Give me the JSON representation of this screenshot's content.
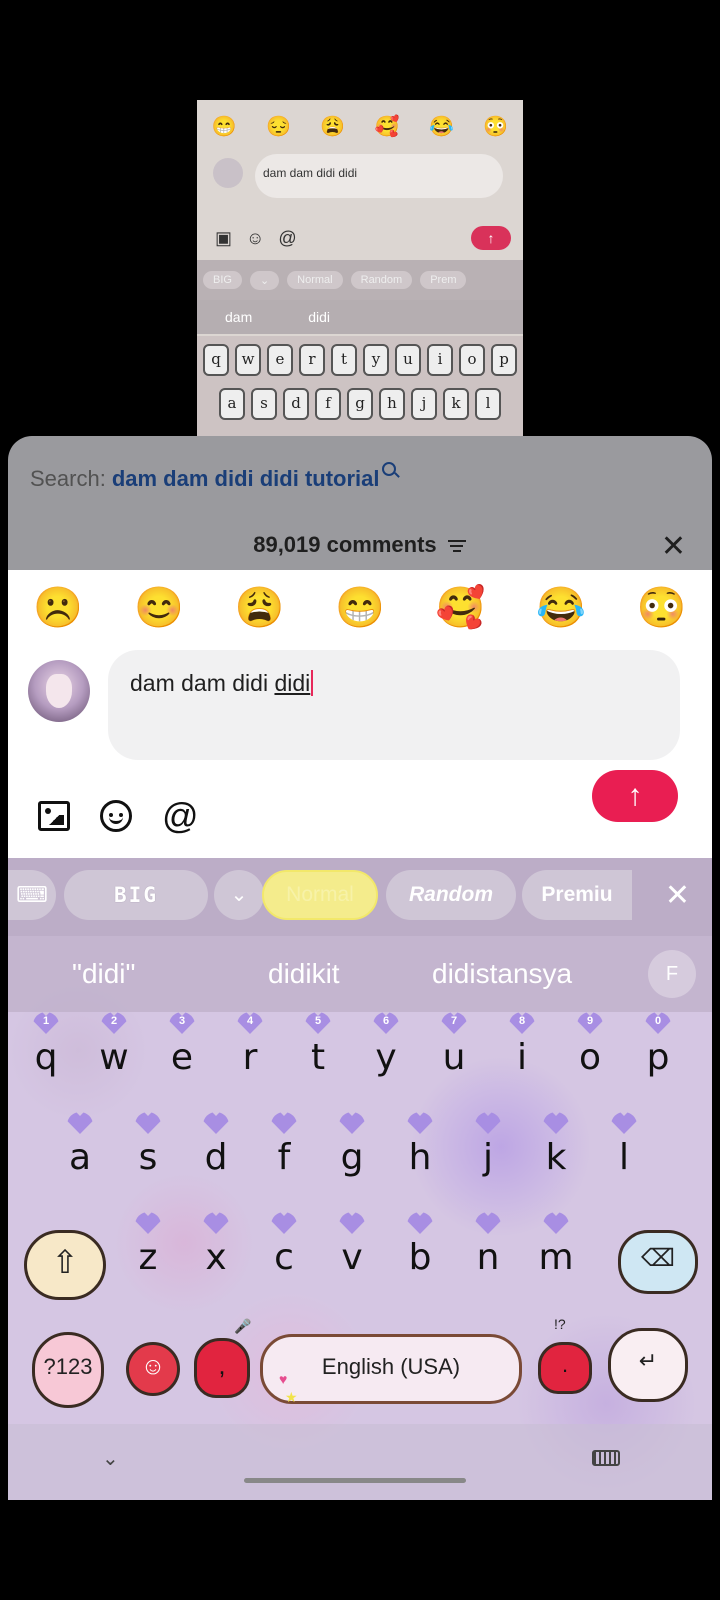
{
  "preview": {
    "emojis": [
      "😁",
      "😔",
      "😩",
      "🥰",
      "😂",
      "😳"
    ],
    "input_text": "dam dam didi didi",
    "send_label": "↑",
    "toolbar": [
      "BIG",
      "⌄",
      "Normal",
      "Random",
      "Prem"
    ],
    "suggestions": [
      "dam",
      "didi"
    ],
    "row1": [
      "q",
      "w",
      "e",
      "r",
      "t",
      "y",
      "u",
      "i",
      "o",
      "p"
    ],
    "row2": [
      "a",
      "s",
      "d",
      "f",
      "g",
      "h",
      "j",
      "k",
      "l"
    ]
  },
  "sheet": {
    "search_label": "Search:",
    "search_query": "dam dam didi didi tutorial",
    "comments_count": "89,019 comments",
    "close": "✕"
  },
  "compose": {
    "emojis": [
      "☹️",
      "😊",
      "😩",
      "😁",
      "🥰",
      "😂",
      "😳"
    ],
    "input_text": "dam dam didi ",
    "input_current_word": "didi",
    "send_label": "↑",
    "at_symbol": "@"
  },
  "keyboard": {
    "toolbar": {
      "theme_icon": "⌨",
      "big_label": "BIG",
      "chevron": "⌄",
      "normal_label": "Normal",
      "random_label": "Random",
      "premium_label": "Premiu",
      "close": "✕"
    },
    "suggestions": [
      "\"didi\"",
      "didikit",
      "didistansya"
    ],
    "font_toggle": "F",
    "numbers": [
      "1",
      "2",
      "3",
      "4",
      "5",
      "6",
      "7",
      "8",
      "9",
      "0"
    ],
    "row1": [
      "q",
      "w",
      "e",
      "r",
      "t",
      "y",
      "u",
      "i",
      "o",
      "p"
    ],
    "row2": [
      "a",
      "s",
      "d",
      "f",
      "g",
      "h",
      "j",
      "k",
      "l"
    ],
    "row3": [
      "z",
      "x",
      "c",
      "v",
      "b",
      "n",
      "m"
    ],
    "shift": "⇧",
    "backspace": "⌫",
    "num_key": "?123",
    "emoji_key": "☺",
    "comma_key": ",",
    "space_label": "English (USA)",
    "period_key": ".",
    "punct_hint": "!?",
    "enter_key": "↵",
    "hide": "⌄",
    "accent_color": "#a88ee3"
  },
  "colors": {
    "send": "#e91e52",
    "search_query": "#1a3e78",
    "sheet_head": "#9a9a9e"
  }
}
